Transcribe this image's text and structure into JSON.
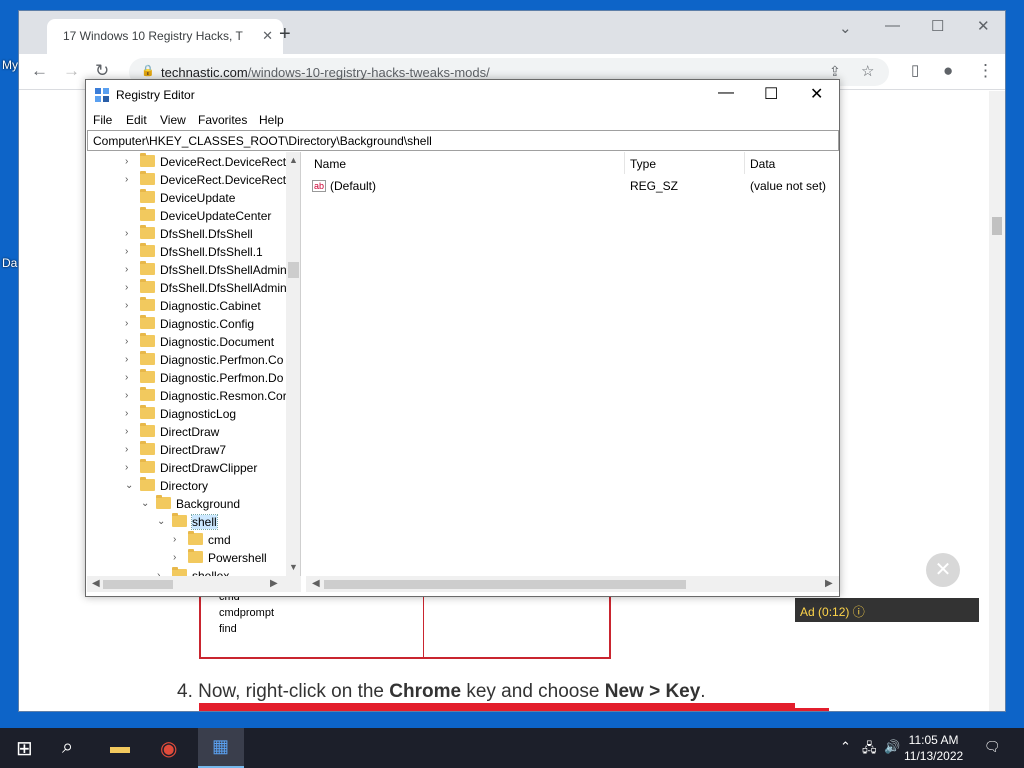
{
  "desktop": {
    "labels": [
      "My",
      "Da"
    ]
  },
  "browser": {
    "tab_title": "17 Windows 10 Registry Hacks, T",
    "url_domain": "technastic.com",
    "url_path": "/windows-10-registry-hacks-tweaks-mods/",
    "article": {
      "bg_items": [
        "cmd",
        "cmdprompt",
        "find"
      ],
      "step_prefix": "4. Now, right-click on the ",
      "step_bold1": "Chrome",
      "step_mid": " key and choose ",
      "step_bold2": "New > Key",
      "step_suffix": "."
    },
    "ad": {
      "label": "Ad",
      "timer": "(0:12)"
    }
  },
  "regedit": {
    "title": "Registry Editor",
    "menu": [
      "File",
      "Edit",
      "View",
      "Favorites",
      "Help"
    ],
    "address": "Computer\\HKEY_CLASSES_ROOT\\Directory\\Background\\shell",
    "tree": [
      {
        "label": "DeviceRect.DeviceRect",
        "depth": 0,
        "exp": ">"
      },
      {
        "label": "DeviceRect.DeviceRect.",
        "depth": 0,
        "exp": ">"
      },
      {
        "label": "DeviceUpdate",
        "depth": 0,
        "exp": ""
      },
      {
        "label": "DeviceUpdateCenter",
        "depth": 0,
        "exp": ""
      },
      {
        "label": "DfsShell.DfsShell",
        "depth": 0,
        "exp": ">"
      },
      {
        "label": "DfsShell.DfsShell.1",
        "depth": 0,
        "exp": ">"
      },
      {
        "label": "DfsShell.DfsShellAdmin",
        "depth": 0,
        "exp": ">"
      },
      {
        "label": "DfsShell.DfsShellAdmin",
        "depth": 0,
        "exp": ">"
      },
      {
        "label": "Diagnostic.Cabinet",
        "depth": 0,
        "exp": ">"
      },
      {
        "label": "Diagnostic.Config",
        "depth": 0,
        "exp": ">"
      },
      {
        "label": "Diagnostic.Document",
        "depth": 0,
        "exp": ">"
      },
      {
        "label": "Diagnostic.Perfmon.Co",
        "depth": 0,
        "exp": ">"
      },
      {
        "label": "Diagnostic.Perfmon.Do",
        "depth": 0,
        "exp": ">"
      },
      {
        "label": "Diagnostic.Resmon.Cor",
        "depth": 0,
        "exp": ">"
      },
      {
        "label": "DiagnosticLog",
        "depth": 0,
        "exp": ">"
      },
      {
        "label": "DirectDraw",
        "depth": 0,
        "exp": ">"
      },
      {
        "label": "DirectDraw7",
        "depth": 0,
        "exp": ">"
      },
      {
        "label": "DirectDrawClipper",
        "depth": 0,
        "exp": ">"
      },
      {
        "label": "Directory",
        "depth": 0,
        "exp": "v"
      },
      {
        "label": "Background",
        "depth": 1,
        "exp": "v"
      },
      {
        "label": "shell",
        "depth": 2,
        "exp": "v",
        "selected": true
      },
      {
        "label": "cmd",
        "depth": 3,
        "exp": ">"
      },
      {
        "label": "Powershell",
        "depth": 3,
        "exp": ">"
      },
      {
        "label": "shellex",
        "depth": 2,
        "exp": ">"
      }
    ],
    "columns": {
      "name": "Name",
      "type": "Type",
      "data": "Data"
    },
    "values": [
      {
        "name": "(Default)",
        "type": "REG_SZ",
        "data": "(value not set)"
      }
    ]
  },
  "taskbar": {
    "time": "11:05 AM",
    "date": "11/13/2022"
  }
}
